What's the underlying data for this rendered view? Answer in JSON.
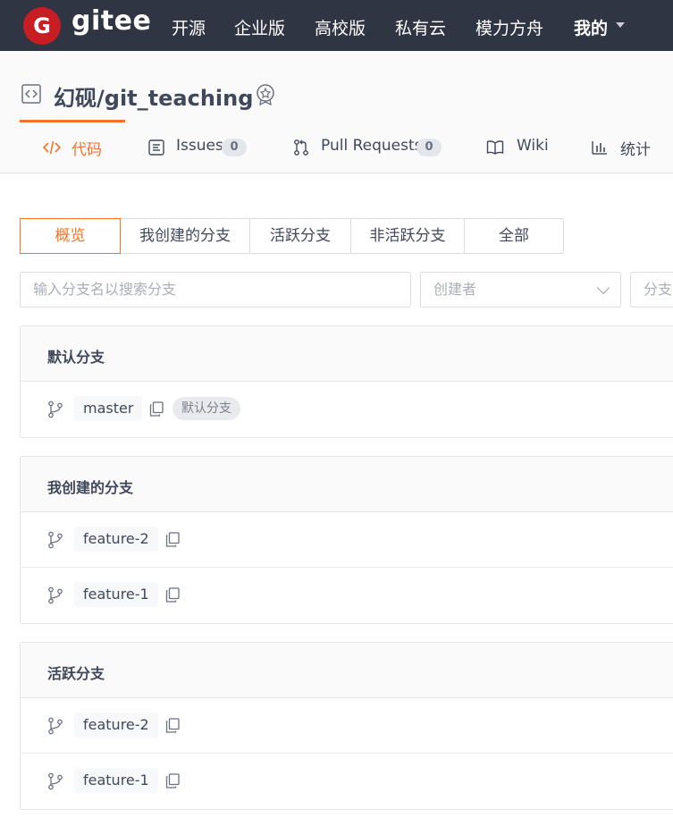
{
  "brand": {
    "logo_letter": "G",
    "name": "gitee",
    "accent": "#c71d23"
  },
  "nav": {
    "items": [
      "开源",
      "企业版",
      "高校版",
      "私有云",
      "模力方舟"
    ],
    "user_menu": "我的"
  },
  "repo": {
    "title": "幻砚/git_teaching",
    "icon": "code-brackets-icon",
    "badge_icon": "award-icon"
  },
  "tabs": [
    {
      "label": "代码",
      "icon": "code-icon",
      "active": true
    },
    {
      "label": "Issues",
      "count": "0",
      "icon": "issues-icon"
    },
    {
      "label": "Pull Requests",
      "count": "0",
      "icon": "pull-request-icon"
    },
    {
      "label": "Wiki",
      "icon": "book-icon"
    },
    {
      "label": "统计",
      "icon": "stats-icon"
    }
  ],
  "filters": [
    "概览",
    "我创建的分支",
    "活跃分支",
    "非活跃分支",
    "全部"
  ],
  "search": {
    "placeholder": "输入分支名以搜索分支",
    "creator_placeholder": "创建者",
    "third_placeholder": "分支"
  },
  "sections": {
    "default": {
      "title": "默认分支",
      "branches": [
        {
          "name": "master",
          "tag": "默认分支"
        }
      ]
    },
    "mine": {
      "title": "我创建的分支",
      "branches": [
        {
          "name": "feature-2"
        },
        {
          "name": "feature-1"
        }
      ]
    },
    "active": {
      "title": "活跃分支",
      "branches": [
        {
          "name": "feature-2"
        },
        {
          "name": "feature-1"
        }
      ]
    }
  },
  "colors": {
    "nav_bg": "#2f3542",
    "accent_orange": "#f1742a"
  }
}
